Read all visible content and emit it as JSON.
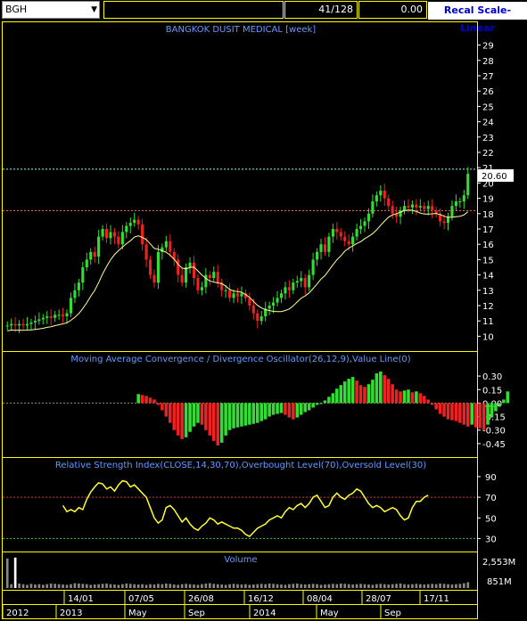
{
  "toolbar": {
    "symbol": "BGH",
    "position": "41/128",
    "value": "0.00",
    "recal_label": "Recal Scale-Linear"
  },
  "colors": {
    "background": "#000000",
    "panel_border": "#ffff00",
    "title_text": "#6699ff",
    "up_candle": "#33dd33",
    "down_candle": "#ee2222",
    "ma_line": "#ffff99",
    "rsi_line": "#ffff33",
    "price_marker": "#ffffff"
  },
  "chart_data": [
    {
      "type": "candlestick",
      "title": "BANGKOK DUSIT MEDICAL [week]",
      "y_ticks": [
        10,
        11,
        12,
        13,
        14,
        15,
        16,
        17,
        18,
        19,
        20,
        21,
        22,
        23,
        24,
        25,
        26,
        27,
        28,
        29
      ],
      "ylim": [
        9.5,
        29.5
      ],
      "last_price": "20.60",
      "reference_lines": [
        20.9,
        18.2
      ],
      "close": [
        10.7,
        10.8,
        10.7,
        10.8,
        10.7,
        10.8,
        10.9,
        11.0,
        11.1,
        11.2,
        11.3,
        11.2,
        11.4,
        11.4,
        11.3,
        11.5,
        12.5,
        13.0,
        13.5,
        14.5,
        15.0,
        15.5,
        15.2,
        16.5,
        17.0,
        16.4,
        16.8,
        16.5,
        16.0,
        16.8,
        17.2,
        17.4,
        17.6,
        17.3,
        16.0,
        15.0,
        14.0,
        13.5,
        15.5,
        15.8,
        16.2,
        15.5,
        15.0,
        14.0,
        13.5,
        14.5,
        14.8,
        13.8,
        13.0,
        13.2,
        14.0,
        13.8,
        14.2,
        13.5,
        13.0,
        13.0,
        12.5,
        12.8,
        12.6,
        12.8,
        12.5,
        12.0,
        11.5,
        11.0,
        11.3,
        11.8,
        12.0,
        12.2,
        12.5,
        12.8,
        13.2,
        13.0,
        13.5,
        13.6,
        13.8,
        13.2,
        14.0,
        15.0,
        15.5,
        16.0,
        15.5,
        16.5,
        17.0,
        16.8,
        16.5,
        16.2,
        16.0,
        16.5,
        17.0,
        17.2,
        17.5,
        18.0,
        18.8,
        19.2,
        19.5,
        19.0,
        18.5,
        18.0,
        17.8,
        18.2,
        18.5,
        18.4,
        18.6,
        18.4,
        18.5,
        18.3,
        18.5,
        18.2,
        18.0,
        17.5,
        17.4,
        17.8,
        18.5,
        18.8,
        18.8,
        19.2,
        20.6
      ]
    },
    {
      "type": "bar",
      "title": "Moving Average Convergence / Divergence Oscillator(26,12,9),Value Line(0)",
      "y_ticks": [
        0.3,
        0.15,
        0.0,
        -0.15,
        -0.3,
        -0.45
      ],
      "tick_labels": [
        "0.30",
        "0.15",
        "0.00",
        "-0.15",
        "-0.30",
        "-0.45"
      ],
      "ylim": [
        -0.55,
        0.42
      ],
      "start_index": 33,
      "values": [
        0.1,
        0.09,
        0.08,
        0.06,
        0.04,
        -0.02,
        -0.08,
        -0.15,
        -0.22,
        -0.3,
        -0.36,
        -0.4,
        -0.38,
        -0.32,
        -0.26,
        -0.22,
        -0.24,
        -0.3,
        -0.36,
        -0.42,
        -0.47,
        -0.44,
        -0.36,
        -0.3,
        -0.28,
        -0.27,
        -0.26,
        -0.25,
        -0.24,
        -0.23,
        -0.22,
        -0.2,
        -0.18,
        -0.15,
        -0.13,
        -0.12,
        -0.11,
        -0.13,
        -0.16,
        -0.18,
        -0.16,
        -0.13,
        -0.1,
        -0.08,
        -0.05,
        -0.02,
        0.0,
        0.03,
        0.07,
        0.11,
        0.16,
        0.2,
        0.24,
        0.27,
        0.29,
        0.25,
        0.2,
        0.18,
        0.21,
        0.26,
        0.33,
        0.35,
        0.31,
        0.27,
        0.21,
        0.15,
        0.13,
        0.14,
        0.15,
        0.12,
        0.13,
        0.11,
        0.08,
        0.04,
        -0.02,
        -0.07,
        -0.12,
        -0.15,
        -0.18,
        -0.19,
        -0.2,
        -0.22,
        -0.24,
        -0.26,
        -0.24,
        -0.27,
        -0.28,
        -0.3,
        -0.24,
        -0.16,
        -0.09,
        -0.03,
        0.04,
        0.13
      ]
    },
    {
      "type": "line",
      "title": "Relative Strength Index(CLOSE,14,30,70),Overbought Level(70),Oversold Level(30)",
      "y_ticks": [
        30,
        50,
        70,
        90
      ],
      "ylim": [
        20,
        96
      ],
      "levels": [
        70,
        30
      ],
      "start_index": 14,
      "values": [
        62,
        56,
        58,
        56,
        60,
        58,
        68,
        75,
        80,
        84,
        83,
        78,
        80,
        76,
        82,
        86,
        85,
        80,
        82,
        78,
        74,
        70,
        60,
        50,
        45,
        48,
        60,
        62,
        58,
        52,
        46,
        50,
        44,
        40,
        38,
        42,
        45,
        50,
        48,
        44,
        46,
        44,
        42,
        40,
        40,
        38,
        34,
        32,
        36,
        40,
        42,
        44,
        48,
        50,
        52,
        50,
        56,
        60,
        58,
        62,
        64,
        60,
        64,
        70,
        72,
        66,
        60,
        62,
        70,
        74,
        70,
        68,
        72,
        74,
        78,
        76,
        70,
        64,
        60,
        62,
        60,
        56,
        58,
        60,
        58,
        52,
        48,
        50,
        60,
        66,
        66,
        70,
        72
      ]
    },
    {
      "type": "bar",
      "title": "Volume",
      "y_ticks": [
        "2,553M",
        "851M"
      ],
      "highlight_index": 2,
      "values": [
        0.92,
        0.12,
        0.95,
        0.14,
        0.12,
        0.1,
        0.13,
        0.11,
        0.12,
        0.1,
        0.12,
        0.14,
        0.13,
        0.12,
        0.11,
        0.1,
        0.12,
        0.15,
        0.14,
        0.13,
        0.12,
        0.1,
        0.11,
        0.12,
        0.13,
        0.14,
        0.12,
        0.11,
        0.1,
        0.12,
        0.14,
        0.13,
        0.12,
        0.11,
        0.12,
        0.1,
        0.12,
        0.11,
        0.13,
        0.12,
        0.14,
        0.13,
        0.11,
        0.1,
        0.12,
        0.13,
        0.12,
        0.11,
        0.1,
        0.12,
        0.14,
        0.15,
        0.13,
        0.12,
        0.11,
        0.1,
        0.12,
        0.13,
        0.12,
        0.11,
        0.12,
        0.1,
        0.11,
        0.12,
        0.13,
        0.12,
        0.14,
        0.13,
        0.12,
        0.11,
        0.1,
        0.12,
        0.13,
        0.14,
        0.12,
        0.11,
        0.12,
        0.13,
        0.12,
        0.1,
        0.11,
        0.12,
        0.13,
        0.12,
        0.14,
        0.13,
        0.12,
        0.11,
        0.12,
        0.13,
        0.12,
        0.11,
        0.1,
        0.12,
        0.13,
        0.12,
        0.11,
        0.12,
        0.13,
        0.14,
        0.12,
        0.11,
        0.12,
        0.13,
        0.12,
        0.11,
        0.12,
        0.13,
        0.12,
        0.14,
        0.13,
        0.12,
        0.11,
        0.12,
        0.13,
        0.15,
        0.18
      ]
    }
  ],
  "x_axis": {
    "top_labels": [
      "14/01",
      "07/05",
      "26/08",
      "16/12",
      "08/04",
      "28/07",
      "17/11"
    ],
    "bottom_labels": [
      "2012",
      "2013",
      "May",
      "Sep",
      "2014",
      "May",
      "Sep"
    ]
  }
}
